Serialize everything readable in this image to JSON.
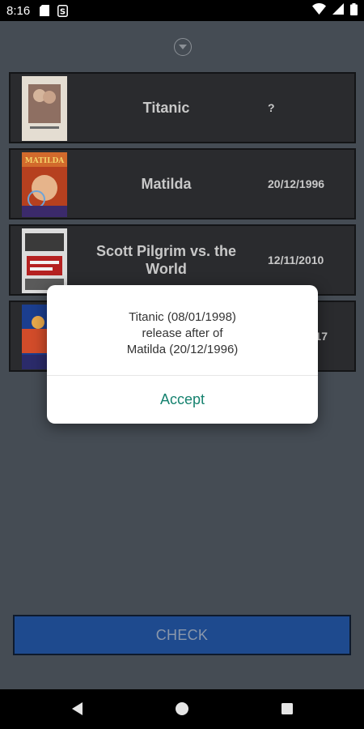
{
  "status_bar": {
    "time": "8:16",
    "icons": [
      "sd-card-icon",
      "s-notification-icon",
      "wifi-icon",
      "signal-icon",
      "battery-icon"
    ]
  },
  "app": {
    "collapse_icon": "chevron-down-circle-icon",
    "movies": [
      {
        "title": "Titanic",
        "date": "?",
        "poster_colors": [
          "#cfc7bc",
          "#6b4a3f"
        ]
      },
      {
        "title": "Matilda",
        "date": "20/12/1996",
        "poster_colors": [
          "#b64325",
          "#e8c24a"
        ]
      },
      {
        "title": "Scott Pilgrim vs. the World",
        "date": "12/11/2010",
        "poster_colors": [
          "#d9d9d9",
          "#a81d1d"
        ]
      },
      {
        "title": "",
        "date": "17",
        "poster_colors": [
          "#1b3e8f",
          "#d24c2a"
        ]
      }
    ],
    "check_button": "CHECK"
  },
  "dialog": {
    "line1": "Titanic (08/01/1998)",
    "line2": "release after of",
    "line3": "Matilda (20/12/1996)",
    "accept_label": "Accept"
  },
  "nav_bar": {
    "icons": [
      "back-icon",
      "home-icon",
      "recents-icon"
    ]
  },
  "colors": {
    "app_background": "#454c54",
    "card_background": "#2a2b2e",
    "check_button": "#1e4a8e",
    "accent": "#16826f"
  }
}
